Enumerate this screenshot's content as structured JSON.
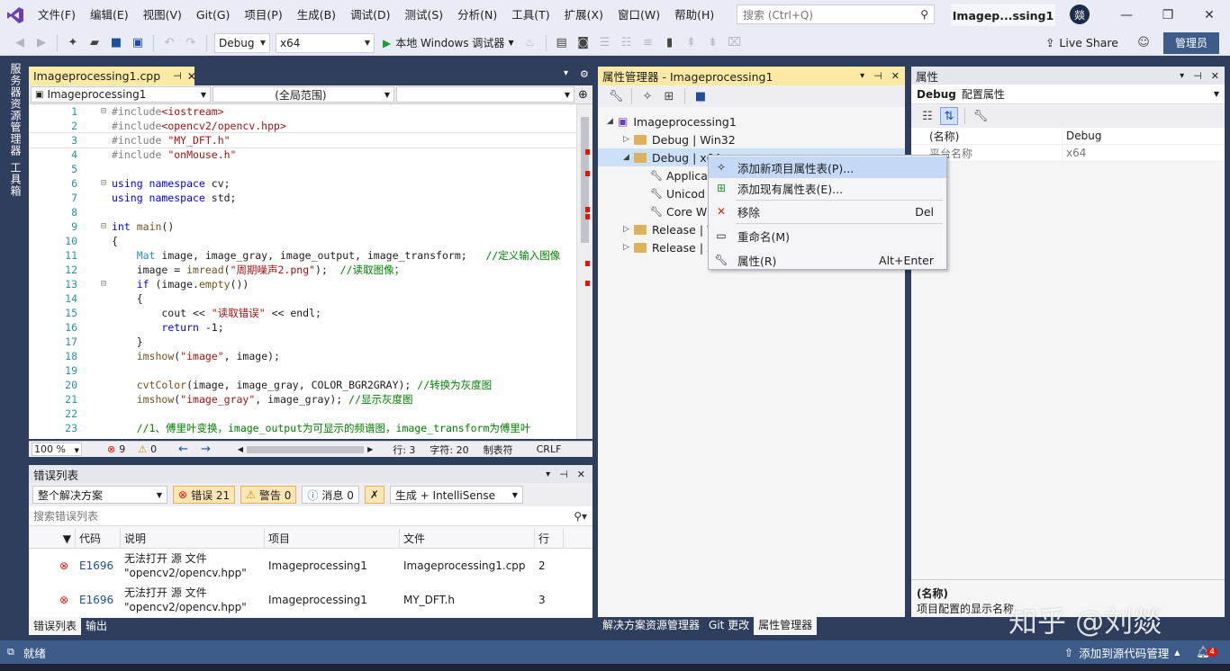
{
  "menu": [
    "文件(F)",
    "编辑(E)",
    "视图(V)",
    "Git(G)",
    "项目(P)",
    "生成(B)",
    "调试(D)",
    "测试(S)",
    "分析(N)",
    "工具(T)",
    "扩展(X)",
    "窗口(W)",
    "帮助(H)"
  ],
  "search": {
    "placeholder": "搜索 (Ctrl+Q)"
  },
  "title_tab": "Imagep...ssing1",
  "avatar": "燚",
  "toolbar": {
    "config": "Debug",
    "platform": "x64",
    "run_label": "本地 Windows 调试器",
    "live_share": "Live Share",
    "admin": "管理员"
  },
  "left_strip": {
    "solution_explorer": "服务器资源管理器",
    "toolbox": "工具箱"
  },
  "editor": {
    "tab_title": "Imageprocessing1.cpp",
    "nav_project": "Imageprocessing1",
    "nav_scope": "(全局范围)",
    "lines": [
      {
        "n": "1",
        "html": "<span class=\"pp\">#include</span><span class=\"str\">&lt;iostream&gt;</span>"
      },
      {
        "n": "2",
        "html": "<span class=\"pp\">#include</span><span class=\"str\">&lt;opencv2/opencv.hpp&gt;</span>"
      },
      {
        "n": "3",
        "html": "<span class=\"pp\">#include </span><span class=\"str\">\"MY_DFT.h\"</span>"
      },
      {
        "n": "4",
        "html": "<span class=\"pp\">#include </span><span class=\"str\">\"onMouse.h\"</span>"
      },
      {
        "n": "5",
        "html": ""
      },
      {
        "n": "6",
        "html": "<span class=\"kw\">using namespace</span> cv;"
      },
      {
        "n": "7",
        "html": "<span class=\"kw\">using namespace</span> std;"
      },
      {
        "n": "8",
        "html": ""
      },
      {
        "n": "9",
        "html": "<span class=\"kw\">int</span> <span class=\"fn\">main</span>()"
      },
      {
        "n": "10",
        "html": "{"
      },
      {
        "n": "11",
        "html": "    <span class=\"ty\">Mat</span> image, image_gray, image_output, image_transform;   <span class=\"cm\">//定义输入图像</span>"
      },
      {
        "n": "12",
        "html": "    image = <span class=\"fn\">imread</span>(<span class=\"str\">\"周期噪声2.png\"</span>);  <span class=\"cm\">//读取图像；</span>"
      },
      {
        "n": "13",
        "html": "    <span class=\"kw\">if</span> (image.<span class=\"fn\">empty</span>())"
      },
      {
        "n": "14",
        "html": "    {"
      },
      {
        "n": "15",
        "html": "        cout &lt;&lt; <span class=\"str\">\"读取错误\"</span> &lt;&lt; endl;"
      },
      {
        "n": "16",
        "html": "        <span class=\"kw\">return</span> -1;"
      },
      {
        "n": "17",
        "html": "    }"
      },
      {
        "n": "18",
        "html": "    <span class=\"fn\">imshow</span>(<span class=\"str\">\"image\"</span>, image);"
      },
      {
        "n": "19",
        "html": ""
      },
      {
        "n": "20",
        "html": "    <span class=\"fn\">cvtColor</span>(image, image_gray, COLOR_BGR2GRAY); <span class=\"cm\">//转换为灰度图</span>"
      },
      {
        "n": "21",
        "html": "    <span class=\"fn\">imshow</span>(<span class=\"str\">\"image_gray\"</span>, image_gray); <span class=\"cm\">//显示灰度图</span>"
      },
      {
        "n": "22",
        "html": ""
      },
      {
        "n": "23",
        "html": "    <span class=\"cm\">//1、傅里叶变换，image_output为可显示的频谱图，image_transform为傅里叶</span>"
      }
    ],
    "status": {
      "zoom": "100 %",
      "errors": "9",
      "warnings": "0",
      "line": "行: 3",
      "char": "字符: 20",
      "tabs": "制表符",
      "eol": "CRLF"
    }
  },
  "error_list": {
    "title": "错误列表",
    "scope": "整个解决方案",
    "errors_btn": "错误 21",
    "warnings_btn": "警告 0",
    "messages_btn": "消息 0",
    "build_filter": "生成 + IntelliSense",
    "search_placeholder": "搜索错误列表",
    "columns": [
      "代码",
      "说明",
      "项目",
      "文件",
      "行"
    ],
    "rows": [
      {
        "code": "E1696",
        "desc": "无法打开 源 文件 \"opencv2/opencv.hpp\"",
        "project": "Imageprocessing1",
        "file": "Imageprocessing1.cpp",
        "line": "2"
      },
      {
        "code": "E1696",
        "desc": "无法打开 源 文件 \"opencv2/opencv.hpp\"",
        "project": "Imageprocessing1",
        "file": "MY_DFT.h",
        "line": "3"
      }
    ],
    "tabs": [
      "错误列表",
      "输出"
    ]
  },
  "property_manager": {
    "title": "属性管理器 - Imageprocessing1",
    "tree": [
      {
        "label": "Imageprocessing1",
        "level": 0,
        "expander": "◢",
        "kind": "project"
      },
      {
        "label": "Debug | Win32",
        "level": 1,
        "expander": "▷",
        "kind": "folder"
      },
      {
        "label": "Debug | x64",
        "level": 1,
        "expander": "◢",
        "kind": "folder-open"
      },
      {
        "label": "Applica",
        "level": 2,
        "expander": "",
        "kind": "wrench"
      },
      {
        "label": "Unicod",
        "level": 2,
        "expander": "",
        "kind": "wrench"
      },
      {
        "label": "Core W",
        "level": 2,
        "expander": "",
        "kind": "wrench"
      },
      {
        "label": "Release | W",
        "level": 1,
        "expander": "▷",
        "kind": "folder"
      },
      {
        "label": "Release | x",
        "level": 1,
        "expander": "▷",
        "kind": "folder"
      }
    ],
    "bottom_tabs": [
      "解决方案资源管理器",
      "Git 更改",
      "属性管理器"
    ]
  },
  "context_menu": [
    {
      "label": "添加新项目属性表(P)...",
      "shortcut": "",
      "icon": "new-sheet-icon"
    },
    {
      "label": "添加现有属性表(E)...",
      "shortcut": "",
      "icon": "existing-sheet-icon"
    },
    {
      "label": "移除",
      "shortcut": "Del",
      "icon": "remove-icon"
    },
    {
      "label": "重命名(M)",
      "shortcut": "",
      "icon": "rename-icon"
    },
    {
      "label": "属性(R)",
      "shortcut": "Alt+Enter",
      "icon": "wrench-icon"
    }
  ],
  "properties": {
    "title": "属性",
    "object": "Debug",
    "object_type": "配置属性",
    "rows": [
      {
        "name": "(名称)",
        "value": "Debug"
      },
      {
        "name": "平台名称",
        "value": "x64"
      }
    ],
    "desc_title": "(名称)",
    "desc_text": "项目配置的显示名称",
    "watermark": "知乎 @刘燚"
  },
  "statusbar": {
    "ready": "就绪",
    "source_control": "添加到源代码管理",
    "notifications": "4"
  },
  "colors": {
    "accent": "#fbe9a4",
    "chrome": "#2e3e5c",
    "status": "#3e5c8a",
    "error": "#e51400"
  }
}
